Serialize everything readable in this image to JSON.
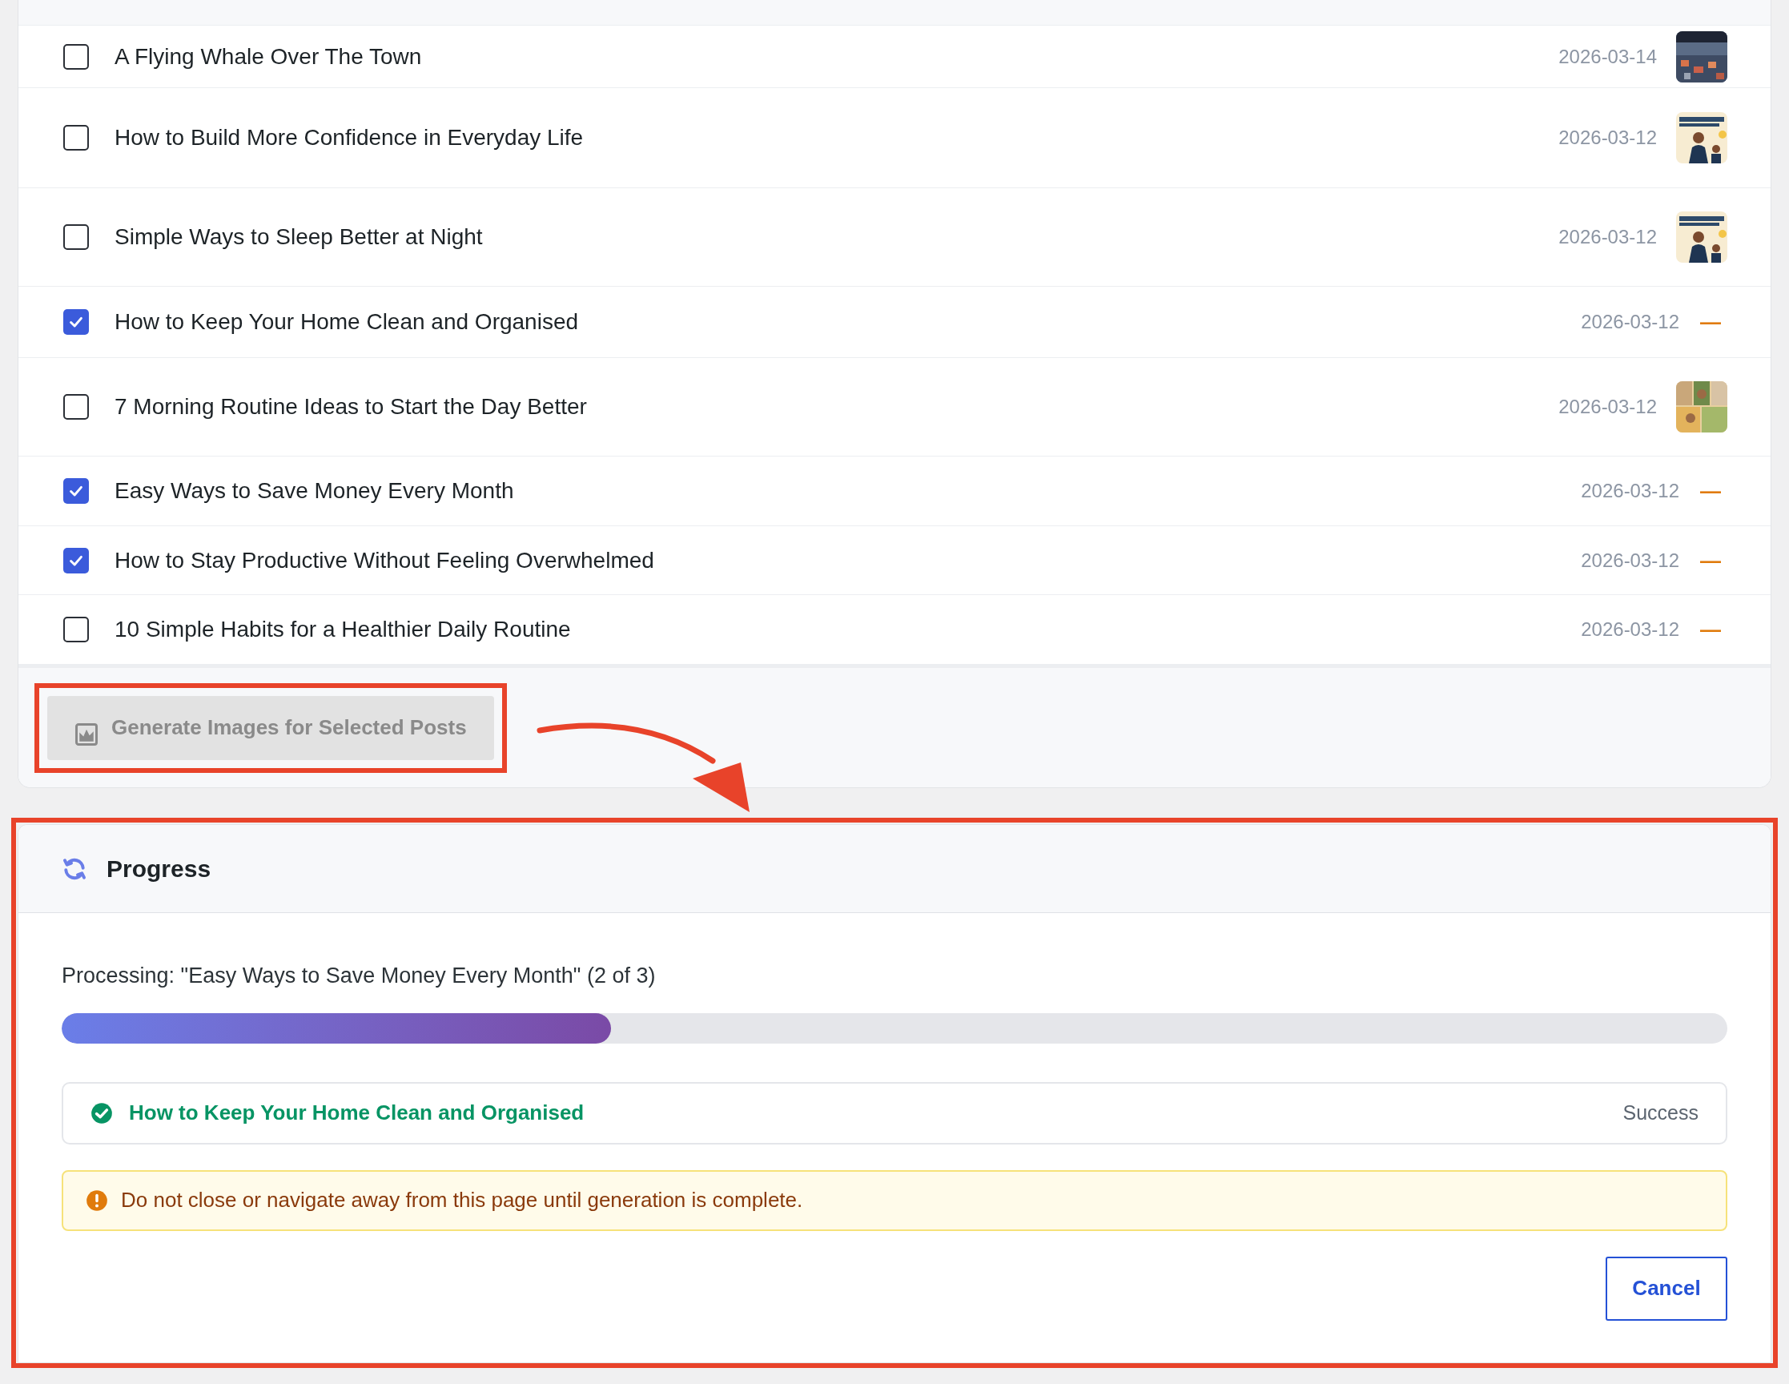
{
  "posts": [
    {
      "title": "A Flying Whale Over The Town",
      "date": "2026-03-14",
      "checked": false,
      "kind": "picture"
    },
    {
      "title": "How to Build More Confidence in Everyday Life",
      "date": "2026-03-12",
      "checked": false,
      "kind": "picture"
    },
    {
      "title": "Simple Ways to Sleep Better at Night",
      "date": "2026-03-12",
      "checked": false,
      "kind": "picture"
    },
    {
      "title": "How to Keep Your Home Clean and Organised",
      "date": "2026-03-12",
      "checked": true,
      "kind": "missing",
      "placeholder": "—"
    },
    {
      "title": "7 Morning Routine Ideas to Start the Day Better",
      "date": "2026-03-12",
      "checked": false,
      "kind": "picture"
    },
    {
      "title": "Easy Ways to Save Money Every Month",
      "date": "2026-03-12",
      "checked": true,
      "kind": "missing",
      "placeholder": "—"
    },
    {
      "title": "How to Stay Productive Without Feeling Overwhelmed",
      "date": "2026-03-12",
      "checked": true,
      "kind": "missing",
      "placeholder": "—"
    },
    {
      "title": "10 Simple Habits for a Healthier Daily Routine",
      "date": "2026-03-12",
      "checked": false,
      "kind": "missing",
      "placeholder": "—"
    }
  ],
  "generate_button": {
    "label": "Generate Images for Selected Posts",
    "disabled": true
  },
  "progress": {
    "title": "Progress",
    "status": "Processing: \"Easy Ways to Save Money Every Month\" (2 of 3)",
    "level": 0.33,
    "results": [
      {
        "title": "How to Keep Your Home Clean and Organised",
        "status": "Success",
        "kind": "success"
      }
    ],
    "warning": "Do not close or navigate away from this page until generation is complete.",
    "cancel_button": "Cancel"
  }
}
